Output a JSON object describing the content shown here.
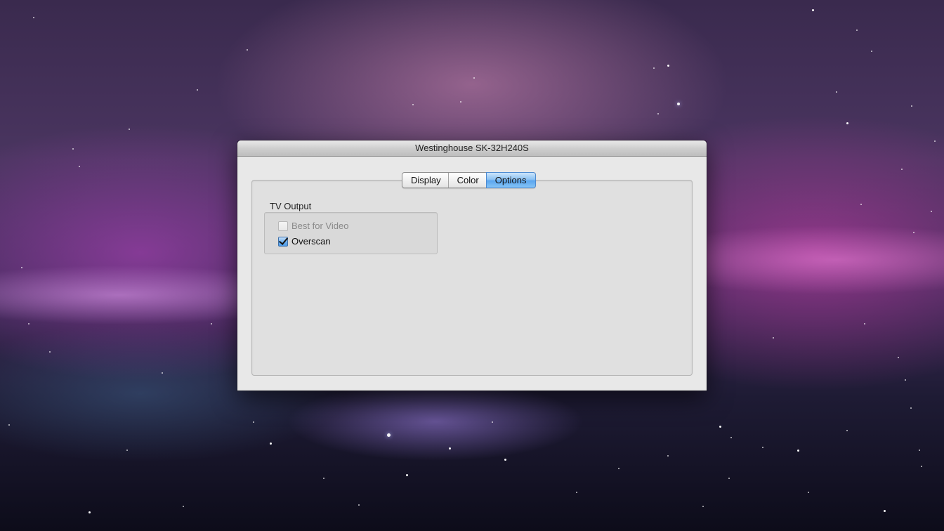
{
  "window": {
    "title": "Westinghouse SK-32H240S"
  },
  "tabs": [
    {
      "label": "Display",
      "selected": false
    },
    {
      "label": "Color",
      "selected": false
    },
    {
      "label": "Options",
      "selected": true
    }
  ],
  "tv_output": {
    "title": "TV Output",
    "options": [
      {
        "label": "Best for Video",
        "checked": false,
        "enabled": false
      },
      {
        "label": "Overscan",
        "checked": true,
        "enabled": true
      }
    ]
  },
  "colors": {
    "selected_tab": "#5aa6ef",
    "window_background": "#e8e8e8"
  }
}
